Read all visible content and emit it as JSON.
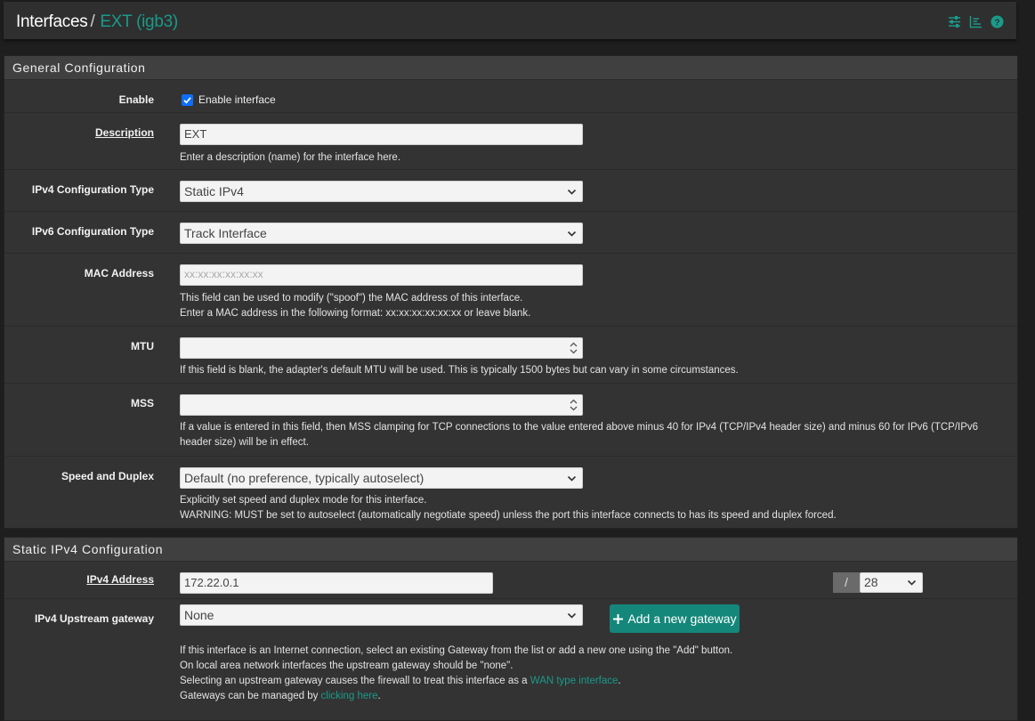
{
  "header": {
    "breadcrumb_root": "Interfaces",
    "separator": "/",
    "breadcrumb_current": "EXT (igb3)",
    "icons": [
      "sliders-icon",
      "bar-chart-icon",
      "help-icon"
    ],
    "accent_color": "#1a9a8a"
  },
  "general": {
    "title": "General Configuration",
    "enable": {
      "label": "Enable",
      "checkbox_label": "Enable interface",
      "checked": true
    },
    "description": {
      "label": "Description",
      "value": "EXT",
      "help": "Enter a description (name) for the interface here."
    },
    "ipv4_type": {
      "label": "IPv4 Configuration Type",
      "value": "Static IPv4"
    },
    "ipv6_type": {
      "label": "IPv6 Configuration Type",
      "value": "Track Interface"
    },
    "mac": {
      "label": "MAC Address",
      "placeholder": "xx:xx:xx:xx:xx:xx",
      "help1": "This field can be used to modify (\"spoof\") the MAC address of this interface.",
      "help2": "Enter a MAC address in the following format: xx:xx:xx:xx:xx:xx or leave blank."
    },
    "mtu": {
      "label": "MTU",
      "value": "",
      "help": "If this field is blank, the adapter's default MTU will be used. This is typically 1500 bytes but can vary in some circumstances."
    },
    "mss": {
      "label": "MSS",
      "value": "",
      "help1": "If a value is entered in this field, then MSS clamping for TCP connections to the value entered above minus 40 for IPv4 (TCP/IPv4 header size) and minus 60 for IPv6 (TCP/IPv6",
      "help2": "header size) will be in effect."
    },
    "speed": {
      "label": "Speed and Duplex",
      "value": "Default (no preference, typically autoselect)",
      "help1": "Explicitly set speed and duplex mode for this interface.",
      "help2": "WARNING: MUST be set to autoselect (automatically negotiate speed) unless the port this interface connects to has its speed and duplex forced."
    }
  },
  "static_ipv4": {
    "title": "Static IPv4 Configuration",
    "address": {
      "label": "IPv4 Address",
      "value": "172.22.0.1",
      "slash": "/",
      "cidr": "28"
    },
    "gateway": {
      "label": "IPv4 Upstream gateway",
      "value": "None",
      "add_button": "Add a new gateway",
      "help1": "If this interface is an Internet connection, select an existing Gateway from the list or add a new one using the \"Add\" button.",
      "help2": "On local area network interfaces the upstream gateway should be \"none\".",
      "help3_pre": "Selecting an upstream gateway causes the firewall to treat this interface as a ",
      "help3_link": "WAN type interface",
      "help3_post": ".",
      "help4_pre": "Gateways can be managed by ",
      "help4_link": "clicking here",
      "help4_post": "."
    }
  }
}
